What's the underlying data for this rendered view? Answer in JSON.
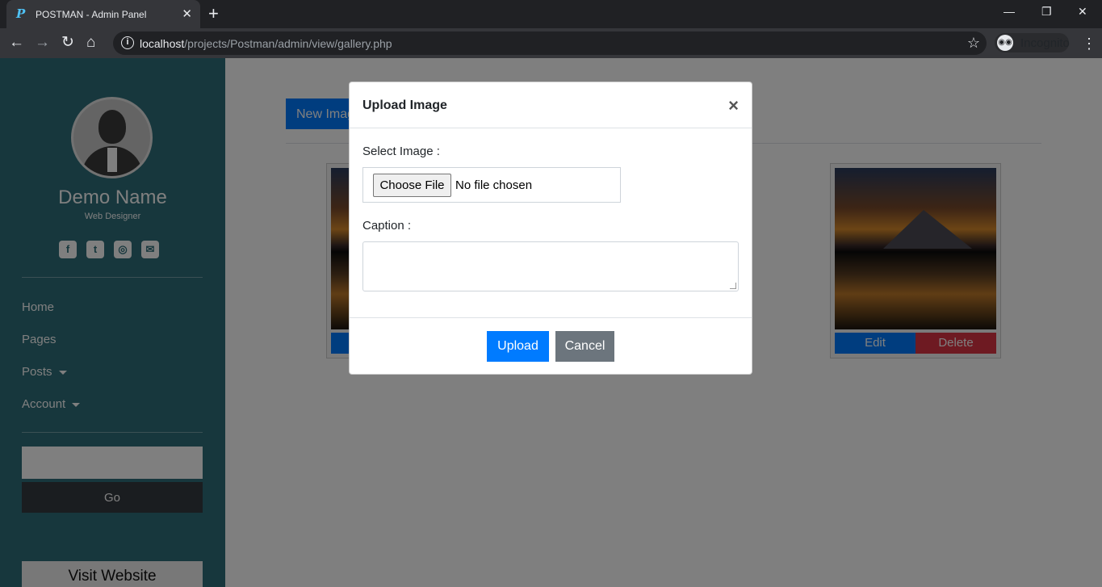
{
  "browser": {
    "tab_title": "POSTMAN - Admin Panel",
    "url_host": "localhost",
    "url_path": "/projects/Postman/admin/view/gallery.php",
    "incognito_label": "Incognito"
  },
  "sidebar": {
    "name": "Demo Name",
    "role": "Web Designer",
    "social_icons": [
      "facebook-icon",
      "twitter-icon",
      "instagram-icon",
      "envelope-icon"
    ],
    "menu": [
      {
        "label": "Home"
      },
      {
        "label": "Pages"
      },
      {
        "label": "Posts"
      },
      {
        "label": "Account"
      }
    ],
    "go_label": "Go",
    "visit_label": "Visit Website"
  },
  "main": {
    "new_image_label": "New Imag",
    "card": {
      "edit_label": "Edit",
      "delete_label": "Delete"
    }
  },
  "modal": {
    "title": "Upload Image",
    "close_glyph": "×",
    "select_label": "Select Image :",
    "choose_file_label": "Choose File",
    "no_file_text": "No file chosen",
    "caption_label": "Caption :",
    "upload_label": "Upload",
    "cancel_label": "Cancel"
  },
  "colors": {
    "sidebar": "#2f6e7a",
    "primary": "#007bff",
    "danger": "#dc3545",
    "secondary": "#6c757d"
  }
}
